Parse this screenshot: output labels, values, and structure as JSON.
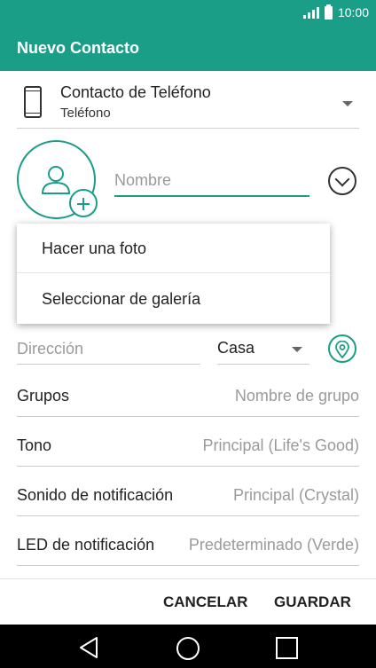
{
  "status_bar": {
    "time": "10:00",
    "icons": [
      "signal-icon",
      "battery-icon"
    ]
  },
  "app_bar": {
    "title": "Nuevo Contacto"
  },
  "account": {
    "title": "Contacto de Teléfono",
    "subtitle": "Teléfono",
    "icon": "phone-icon"
  },
  "contact_form": {
    "name_placeholder": "Nombre",
    "name_value": "",
    "address_placeholder": "Dirección",
    "address_type": "Casa",
    "rows": [
      {
        "label": "Grupos",
        "value": "Nombre de grupo"
      },
      {
        "label": "Tono",
        "value": "Principal (Life's Good)"
      },
      {
        "label": "Sonido de notificación",
        "value": "Principal (Crystal)"
      },
      {
        "label": "LED de notificación",
        "value": "Predeterminado (Verde)"
      }
    ]
  },
  "photo_menu": {
    "items": [
      "Hacer una foto",
      "Seleccionar de galería"
    ]
  },
  "actions": {
    "cancel": "CANCELAR",
    "save": "GUARDAR"
  },
  "colors": {
    "accent": "#1a9e88",
    "nav_bar": "#000000"
  }
}
